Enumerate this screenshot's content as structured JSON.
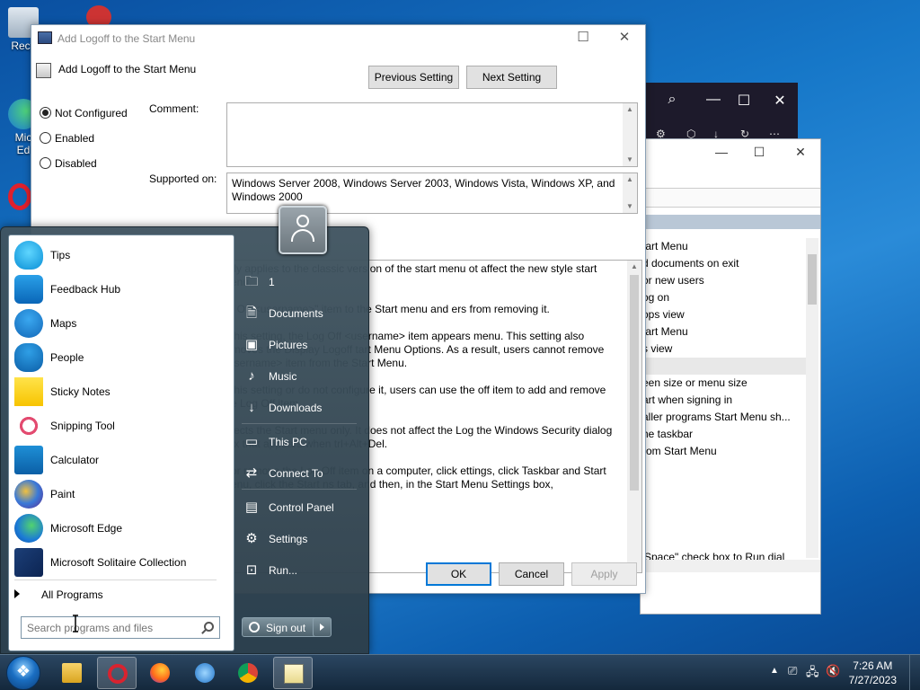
{
  "desktop": {
    "icons": [
      {
        "label": "Recy"
      },
      {
        "label": "Mic"
      },
      {
        "label": "Ed"
      }
    ]
  },
  "bg_white_window": {
    "items": [
      "tart Menu",
      "d documents on exit",
      "or new users",
      "og on",
      "ops view",
      "tart Menu",
      "s view",
      "",
      "een size or menu size",
      "art when signing in",
      "aller programs Start Menu sh...",
      "he taskbar",
      "rom Start Menu"
    ],
    "selected_index": 7,
    "footer_text": "Space\" check box to Run dial"
  },
  "dialog": {
    "window_title": "Add Logoff to the Start Menu",
    "heading": "Add Logoff to the Start Menu",
    "previous_button": "Previous Setting",
    "next_button": "Next Setting",
    "options": [
      {
        "label": "Not Configured",
        "selected": true
      },
      {
        "label": "Enabled",
        "selected": false
      },
      {
        "label": "Disabled",
        "selected": false
      }
    ],
    "comment_label": "Comment:",
    "comment_value": "",
    "supported_label": "Supported on:",
    "supported_value": "Windows Server 2008, Windows Server 2003, Windows Vista, Windows XP, and Windows 2000",
    "help_paragraphs": [
      "only applies to the classic version of the start menu ot affect the new style start menu.",
      "og Off <username>\" item to the Start menu and ers from removing it.",
      "e this setting, the Log Off <username> item appears menu. This setting also removes the Display Logoff tart Menu Options. As a result, users cannot remove <username> item from the Start Menu.",
      "e this setting or do not configure it, users can use the off item to add and remove the Log Off item.",
      "affects the Start menu only. It does not affect the Log the Windows Security dialog box that appears when trl+Alt+Del.",
      "d or remove the Log Off item on a computer, click ettings, click Taskbar and Start Menu, click the Start ns tab, and then, in the Start Menu Settings box,"
    ],
    "ok_button": "OK",
    "cancel_button": "Cancel",
    "apply_button": "Apply"
  },
  "start_menu": {
    "programs": [
      {
        "name": "Tips",
        "icon": "lightbulb-icon"
      },
      {
        "name": "Feedback Hub",
        "icon": "feedback-hub-icon"
      },
      {
        "name": "Maps",
        "icon": "maps-icon"
      },
      {
        "name": "People",
        "icon": "people-icon"
      },
      {
        "name": "Sticky Notes",
        "icon": "sticky-notes-icon"
      },
      {
        "name": "Snipping Tool",
        "icon": "snipping-tool-icon"
      },
      {
        "name": "Calculator",
        "icon": "calculator-icon"
      },
      {
        "name": "Paint",
        "icon": "paint-icon"
      },
      {
        "name": "Microsoft Edge",
        "icon": "edge-icon"
      },
      {
        "name": "Microsoft Solitaire Collection",
        "icon": "solitaire-icon"
      }
    ],
    "all_programs": "All Programs",
    "search_placeholder": "Search programs and files",
    "right_items": [
      {
        "label": "1",
        "icon": "user-folder-icon"
      },
      {
        "label": "Documents",
        "icon": "documents-icon"
      },
      {
        "label": "Pictures",
        "icon": "pictures-icon"
      },
      {
        "label": "Music",
        "icon": "music-icon"
      },
      {
        "label": "Downloads",
        "icon": "downloads-icon"
      },
      {
        "label": "This PC",
        "icon": "computer-icon"
      },
      {
        "label": "Connect To",
        "icon": "connect-icon"
      },
      {
        "label": "Control Panel",
        "icon": "control-panel-icon"
      },
      {
        "label": "Settings",
        "icon": "gear-icon"
      },
      {
        "label": "Run...",
        "icon": "run-icon"
      }
    ],
    "sign_out": "Sign out"
  },
  "taskbar": {
    "time": "7:26 AM",
    "date": "7/27/2023"
  },
  "colors": {
    "accent": "#0078d7",
    "desktop": "#1677c8",
    "taskbar": "#14283c"
  }
}
